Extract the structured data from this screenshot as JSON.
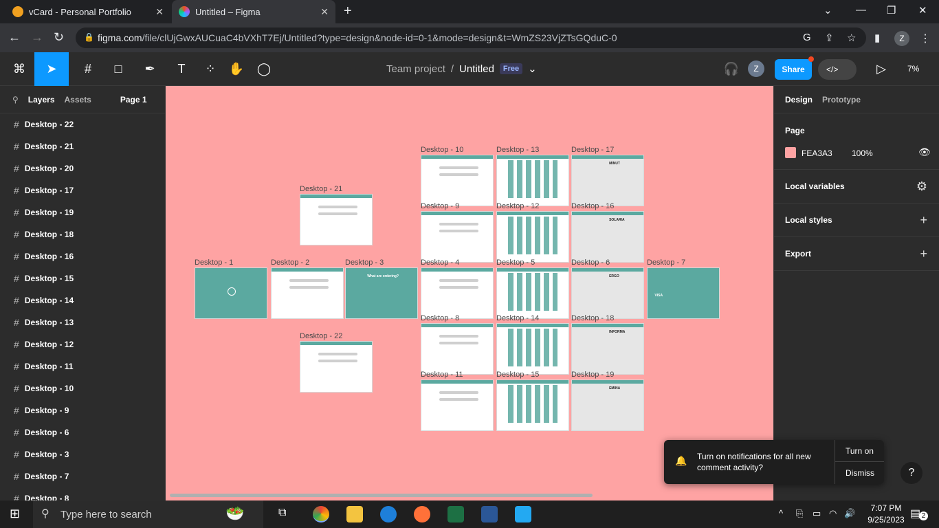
{
  "browser": {
    "tabs": [
      {
        "title": "vCard - Personal Portfolio",
        "favicon_color": "#f0a020"
      },
      {
        "title": "Untitled – Figma",
        "favicon_color": "#a259ff"
      }
    ],
    "url_host": "figma.com",
    "url_path": "/file/clUjGwxAUCuaC4bVXhT7Ej/Untitled?type=design&node-id=0-1&mode=design&t=WmZS23VjZTsGQduC-0",
    "profile_initial": "Z"
  },
  "toolbar": {
    "team": "Team project",
    "separator": "/",
    "file": "Untitled",
    "plan_badge": "Free",
    "avatar_initial": "Z",
    "share_label": "Share",
    "zoom": "7%"
  },
  "layers_panel": {
    "tab_layers": "Layers",
    "tab_assets": "Assets",
    "page": "Page 1",
    "items": [
      "Desktop - 22",
      "Desktop - 21",
      "Desktop - 20",
      "Desktop - 17",
      "Desktop - 19",
      "Desktop - 18",
      "Desktop - 16",
      "Desktop - 15",
      "Desktop - 14",
      "Desktop - 13",
      "Desktop - 12",
      "Desktop - 11",
      "Desktop - 10",
      "Desktop - 9",
      "Desktop - 6",
      "Desktop - 3",
      "Desktop - 7",
      "Desktop - 8"
    ]
  },
  "canvas": {
    "background": "#fea3a3",
    "frames": [
      "Desktop - 1",
      "Desktop - 2",
      "Desktop - 3",
      "Desktop - 21",
      "Desktop - 22",
      "Desktop - 10",
      "Desktop - 13",
      "Desktop - 17",
      "Desktop - 9",
      "Desktop - 12",
      "Desktop - 16",
      "Desktop - 4",
      "Desktop - 5",
      "Desktop - 6",
      "Desktop - 7",
      "Desktop - 8",
      "Desktop - 14",
      "Desktop - 18",
      "Desktop - 11",
      "Desktop - 15",
      "Desktop - 19"
    ],
    "frame_texts": {
      "d3_title": "What are ordering?",
      "d17_brand": "MINUT",
      "d16_brand": "SOLARIA",
      "d6_brand": "ERGO",
      "d18_brand": "INFORMA",
      "d19_brand": "EMINA",
      "d7_card": "VISA"
    }
  },
  "right_panel": {
    "tab_design": "Design",
    "tab_prototype": "Prototype",
    "page_heading": "Page",
    "page_color": "FEA3A3",
    "page_opacity": "100%",
    "local_variables": "Local variables",
    "local_styles": "Local styles",
    "export": "Export"
  },
  "toast": {
    "message": "Turn on notifications for all new comment activity?",
    "turn_on": "Turn on",
    "dismiss": "Dismiss"
  },
  "help": "?",
  "taskbar": {
    "search_placeholder": "Type here to search",
    "time": "7:07 PM",
    "date": "9/25/2023",
    "notification_count": "2"
  }
}
